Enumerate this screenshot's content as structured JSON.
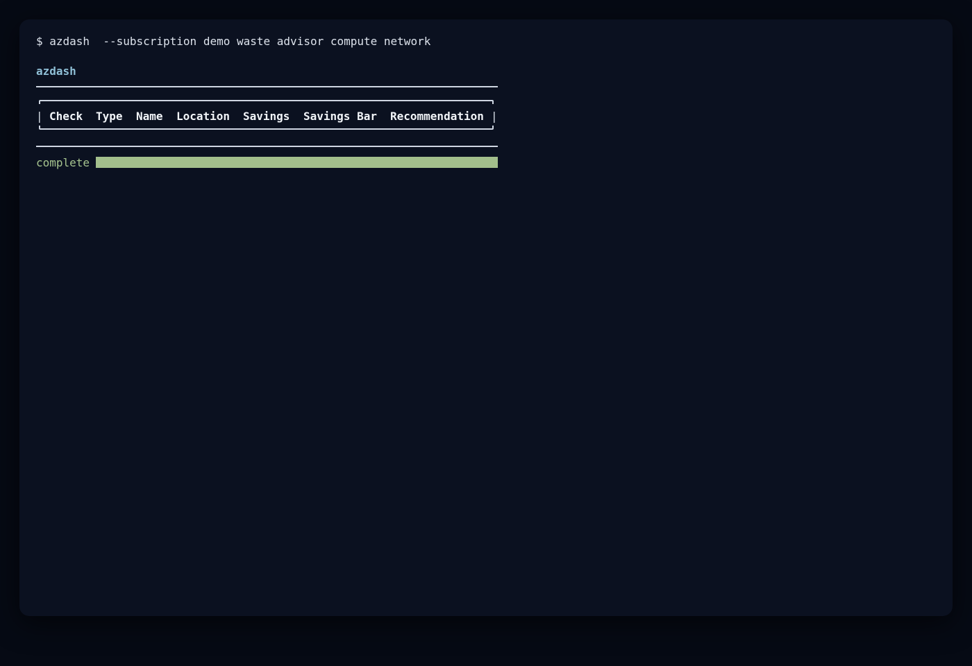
{
  "terminal": {
    "command": "$ azdash  --subscription demo waste advisor compute network",
    "app_title": "azdash",
    "table": {
      "columns": [
        "Check",
        "Type",
        "Name",
        "Location",
        "Savings",
        "Savings Bar",
        "Recommendation"
      ],
      "rows": []
    },
    "progress": {
      "label": "complete",
      "value_percent": 100
    }
  },
  "colors": {
    "background": "#060a14",
    "window": "#0b1120",
    "text": "#dde3ec",
    "title_accent": "#8fbfd6",
    "progress_green": "#a3bf8c"
  }
}
